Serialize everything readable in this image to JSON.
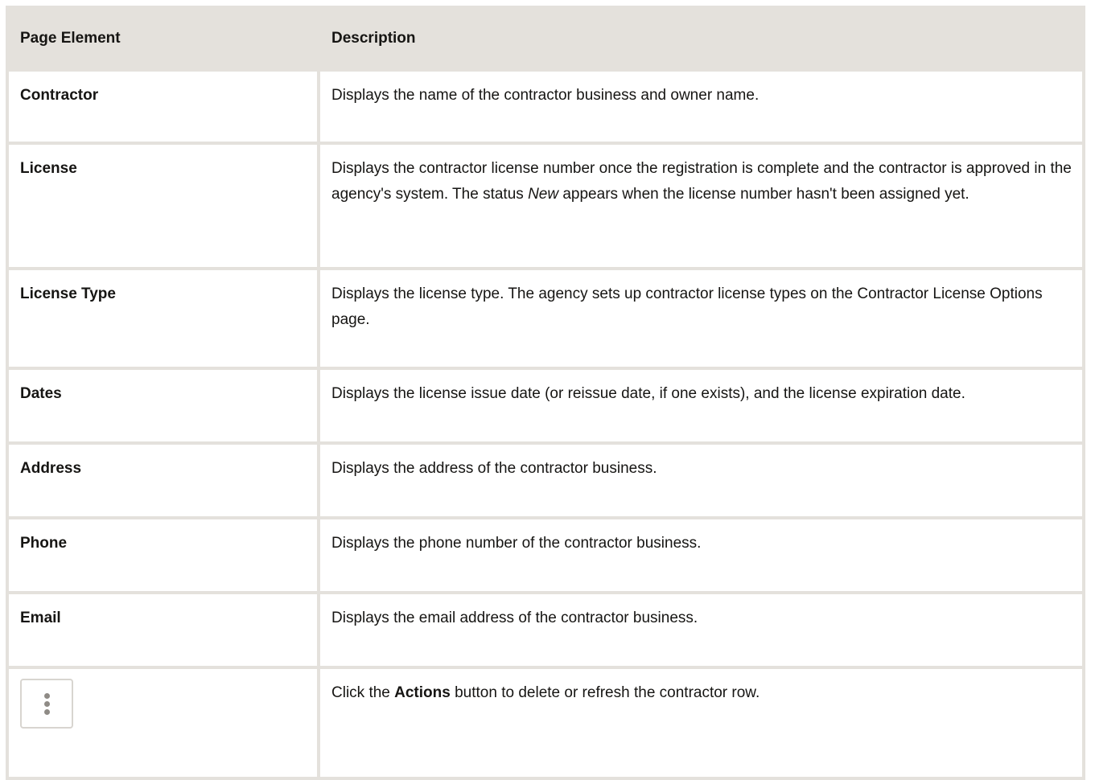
{
  "table": {
    "headers": {
      "element": "Page Element",
      "description": "Description"
    },
    "rows": [
      {
        "element": "Contractor",
        "description": "Displays the name of the contractor business and owner name."
      },
      {
        "element": "License",
        "description_pre": "Displays the contractor license number once the registration is complete and the contractor is approved in the agency's system. The status ",
        "description_em": "New",
        "description_post": " appears when the license number hasn't been assigned yet."
      },
      {
        "element": "License Type",
        "description": "Displays the license type. The agency sets up contractor license types on the Contractor License Options page."
      },
      {
        "element": "Dates",
        "description": "Displays the license issue date (or reissue date, if one exists), and the license expiration date."
      },
      {
        "element": "Address",
        "description": "Displays the address of the contractor business."
      },
      {
        "element": "Phone",
        "description": "Displays the phone number of the contractor business."
      },
      {
        "element": "Email",
        "description": "Displays the email address of the contractor business."
      },
      {
        "element_icon": "vertical-ellipsis-icon",
        "description_pre": "Click the ",
        "description_strong": "Actions",
        "description_post": " button to delete or refresh the contractor row."
      }
    ]
  }
}
